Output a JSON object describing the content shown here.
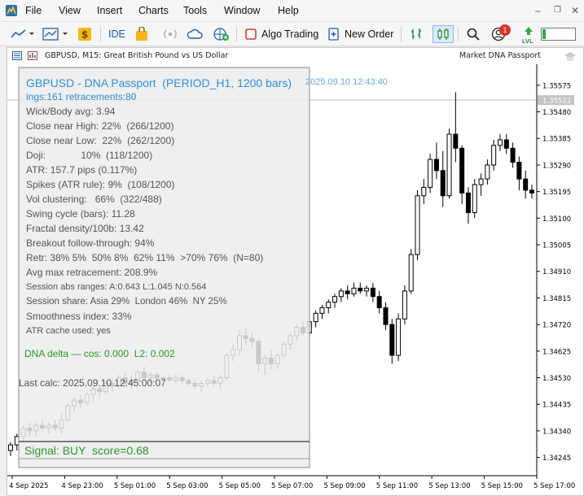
{
  "menu": {
    "items": [
      "File",
      "View",
      "Insert",
      "Charts",
      "Tools",
      "Window",
      "Help"
    ]
  },
  "toolbar": {
    "ide_label": "IDE",
    "algo_trading_label": "Algo Trading",
    "new_order_label": "New Order",
    "notification_count": "1",
    "lvl_label": "LVL"
  },
  "chart_window": {
    "title": "GBPUSD, M15:  Great British Pound vs US Dollar",
    "expert_name": "Market DNA Passport"
  },
  "dna_panel": {
    "headline": "GBPUSD - DNA Passport  (PERIOD_H1, 1200 bars)",
    "timestamp": "2025.09.10 12:43:40",
    "retracement_line": "ings:161 retracements:80",
    "stats": [
      "Wick/Body avg: 3.94",
      "Close near High: 22%  (266/1200)",
      "Close near Low:  22%  (262/1200)",
      "Doji:             10%  (118/1200)",
      "ATR: 157.7 pips (0.117%)",
      "Spikes (ATR rule): 9%  (108/1200)",
      "Vol clustering:   66%  (322/488)",
      "Swing cycle (bars): 11.28",
      "Fractal density/100b: 13.42",
      "Breakout follow-through: 94%",
      "Retr: 38% 5%  50% 8%  62% 11%  >70% 76%  (N=80)",
      "Avg max retracement: 208.9%",
      "Session abs ranges: A:0.643 L:1.045 N:0.564",
      "Session share: Asia 29%  London 46%  NY 25%",
      "Smoothness index: 33%",
      "ATR cache used: yes"
    ],
    "dna_delta": "DNA delta — cos: 0.000  L2: 0.002",
    "last_calc": "Last calc: 2025.09.10 12:45:00:07",
    "signal": "Signal: BUY  score=0.68"
  },
  "chart_data": {
    "type": "candlestick",
    "symbol": "GBPUSD",
    "timeframe": "M15",
    "current_price": "1.35522",
    "y_range": [
      1.3418,
      1.3565
    ],
    "y_ticks": [
      "1.35575",
      "1.35480",
      "1.35385",
      "1.35290",
      "1.35195",
      "1.35100",
      "1.35005",
      "1.34910",
      "1.34815",
      "1.34720",
      "1.34625",
      "1.34530",
      "1.34435",
      "1.34340",
      "1.34245"
    ],
    "x_ticks": [
      "4 Sep 2025",
      "4 Sep 23:00",
      "5 Sep 01:00",
      "5 Sep 03:00",
      "5 Sep 05:00",
      "5 Sep 07:00",
      "5 Sep 09:00",
      "5 Sep 11:00",
      "5 Sep 13:00",
      "5 Sep 15:00",
      "5 Sep 17:00"
    ],
    "candles": [
      [
        1.3427,
        1.343,
        1.3425,
        1.3429
      ],
      [
        1.3429,
        1.3433,
        1.3427,
        1.3432
      ],
      [
        1.3432,
        1.3436,
        1.343,
        1.3435
      ],
      [
        1.3435,
        1.3437,
        1.3432,
        1.3434
      ],
      [
        1.3434,
        1.3437,
        1.3432,
        1.3436
      ],
      [
        1.3436,
        1.3438,
        1.3434,
        1.3435
      ],
      [
        1.3435,
        1.3437,
        1.3433,
        1.3436
      ],
      [
        1.3436,
        1.3438,
        1.3434,
        1.3435
      ],
      [
        1.3435,
        1.344,
        1.3433,
        1.3438
      ],
      [
        1.3438,
        1.3444,
        1.3437,
        1.3443
      ],
      [
        1.3443,
        1.3446,
        1.3441,
        1.3445
      ],
      [
        1.3445,
        1.3447,
        1.3442,
        1.3444
      ],
      [
        1.3444,
        1.3448,
        1.3443,
        1.3447
      ],
      [
        1.3447,
        1.345,
        1.3444,
        1.3449
      ],
      [
        1.3449,
        1.345,
        1.3446,
        1.3448
      ],
      [
        1.3448,
        1.3452,
        1.3447,
        1.3451
      ],
      [
        1.3451,
        1.3453,
        1.3448,
        1.345
      ],
      [
        1.345,
        1.3454,
        1.3449,
        1.3453
      ],
      [
        1.3453,
        1.3455,
        1.345,
        1.3451
      ],
      [
        1.3451,
        1.3454,
        1.3449,
        1.3452
      ],
      [
        1.3452,
        1.3456,
        1.3451,
        1.3455
      ],
      [
        1.3455,
        1.3457,
        1.3452,
        1.3453
      ],
      [
        1.3453,
        1.3455,
        1.3451,
        1.3454
      ],
      [
        1.3454,
        1.3455,
        1.3452,
        1.3453
      ],
      [
        1.3453,
        1.3454,
        1.3452,
        1.3453
      ],
      [
        1.3453,
        1.3454,
        1.3452,
        1.3452
      ],
      [
        1.3452,
        1.3454,
        1.3451,
        1.3453
      ],
      [
        1.3453,
        1.3454,
        1.3451,
        1.3452
      ],
      [
        1.3452,
        1.3453,
        1.345,
        1.3451
      ],
      [
        1.3451,
        1.3452,
        1.3449,
        1.345
      ],
      [
        1.345,
        1.3452,
        1.3448,
        1.3451
      ],
      [
        1.3451,
        1.3453,
        1.345,
        1.3452
      ],
      [
        1.3452,
        1.3454,
        1.345,
        1.3451
      ],
      [
        1.3451,
        1.3454,
        1.3449,
        1.3453
      ],
      [
        1.3453,
        1.3462,
        1.3452,
        1.3461
      ],
      [
        1.3461,
        1.3465,
        1.3459,
        1.3463
      ],
      [
        1.3463,
        1.347,
        1.3461,
        1.3468
      ],
      [
        1.3468,
        1.3471,
        1.3465,
        1.3467
      ],
      [
        1.3467,
        1.3469,
        1.3464,
        1.3466
      ],
      [
        1.3466,
        1.3467,
        1.3455,
        1.3458
      ],
      [
        1.3458,
        1.3461,
        1.3454,
        1.346
      ],
      [
        1.346,
        1.3463,
        1.3456,
        1.3458
      ],
      [
        1.3458,
        1.3462,
        1.3456,
        1.3461
      ],
      [
        1.3461,
        1.3466,
        1.346,
        1.3465
      ],
      [
        1.3465,
        1.3469,
        1.3463,
        1.3468
      ],
      [
        1.3468,
        1.3472,
        1.3466,
        1.3471
      ],
      [
        1.3471,
        1.3473,
        1.3468,
        1.3469
      ],
      [
        1.3469,
        1.3474,
        1.3468,
        1.3473
      ],
      [
        1.3473,
        1.3477,
        1.3471,
        1.3476
      ],
      [
        1.3476,
        1.3479,
        1.3474,
        1.3478
      ],
      [
        1.3478,
        1.3481,
        1.3476,
        1.348
      ],
      [
        1.348,
        1.3483,
        1.3478,
        1.3482
      ],
      [
        1.3482,
        1.3485,
        1.348,
        1.3484
      ],
      [
        1.3484,
        1.3486,
        1.3481,
        1.3483
      ],
      [
        1.3483,
        1.3487,
        1.3482,
        1.3485
      ],
      [
        1.3485,
        1.3487,
        1.3483,
        1.3484
      ],
      [
        1.3484,
        1.3486,
        1.3482,
        1.3485
      ],
      [
        1.3485,
        1.3487,
        1.348,
        1.3482
      ],
      [
        1.3482,
        1.3484,
        1.3476,
        1.3478
      ],
      [
        1.3478,
        1.348,
        1.347,
        1.3472
      ],
      [
        1.3472,
        1.3474,
        1.3458,
        1.3461
      ],
      [
        1.3461,
        1.3476,
        1.3459,
        1.3474
      ],
      [
        1.3474,
        1.3486,
        1.3472,
        1.3484
      ],
      [
        1.3484,
        1.3499,
        1.3483,
        1.3497
      ],
      [
        1.3497,
        1.352,
        1.3495,
        1.3518
      ],
      [
        1.3518,
        1.3524,
        1.3515,
        1.3521
      ],
      [
        1.3521,
        1.3533,
        1.3519,
        1.3531
      ],
      [
        1.3531,
        1.3537,
        1.3524,
        1.3527
      ],
      [
        1.3527,
        1.3534,
        1.3514,
        1.3518
      ],
      [
        1.3518,
        1.3542,
        1.3517,
        1.354
      ],
      [
        1.354,
        1.3555,
        1.353,
        1.3535
      ],
      [
        1.3535,
        1.3536,
        1.3515,
        1.3519
      ],
      [
        1.3519,
        1.3521,
        1.3508,
        1.3512
      ],
      [
        1.3512,
        1.3524,
        1.351,
        1.3522
      ],
      [
        1.3522,
        1.3526,
        1.3518,
        1.3524
      ],
      [
        1.3524,
        1.3531,
        1.3522,
        1.3529
      ],
      [
        1.3529,
        1.3538,
        1.3527,
        1.3536
      ],
      [
        1.3536,
        1.354,
        1.3534,
        1.3538
      ],
      [
        1.3538,
        1.354,
        1.3533,
        1.3535
      ],
      [
        1.3535,
        1.3537,
        1.3528,
        1.353
      ],
      [
        1.353,
        1.3532,
        1.352,
        1.3524
      ],
      [
        1.3524,
        1.3527,
        1.3517,
        1.352
      ],
      [
        1.352,
        1.3522,
        1.3517,
        1.3519
      ]
    ]
  }
}
